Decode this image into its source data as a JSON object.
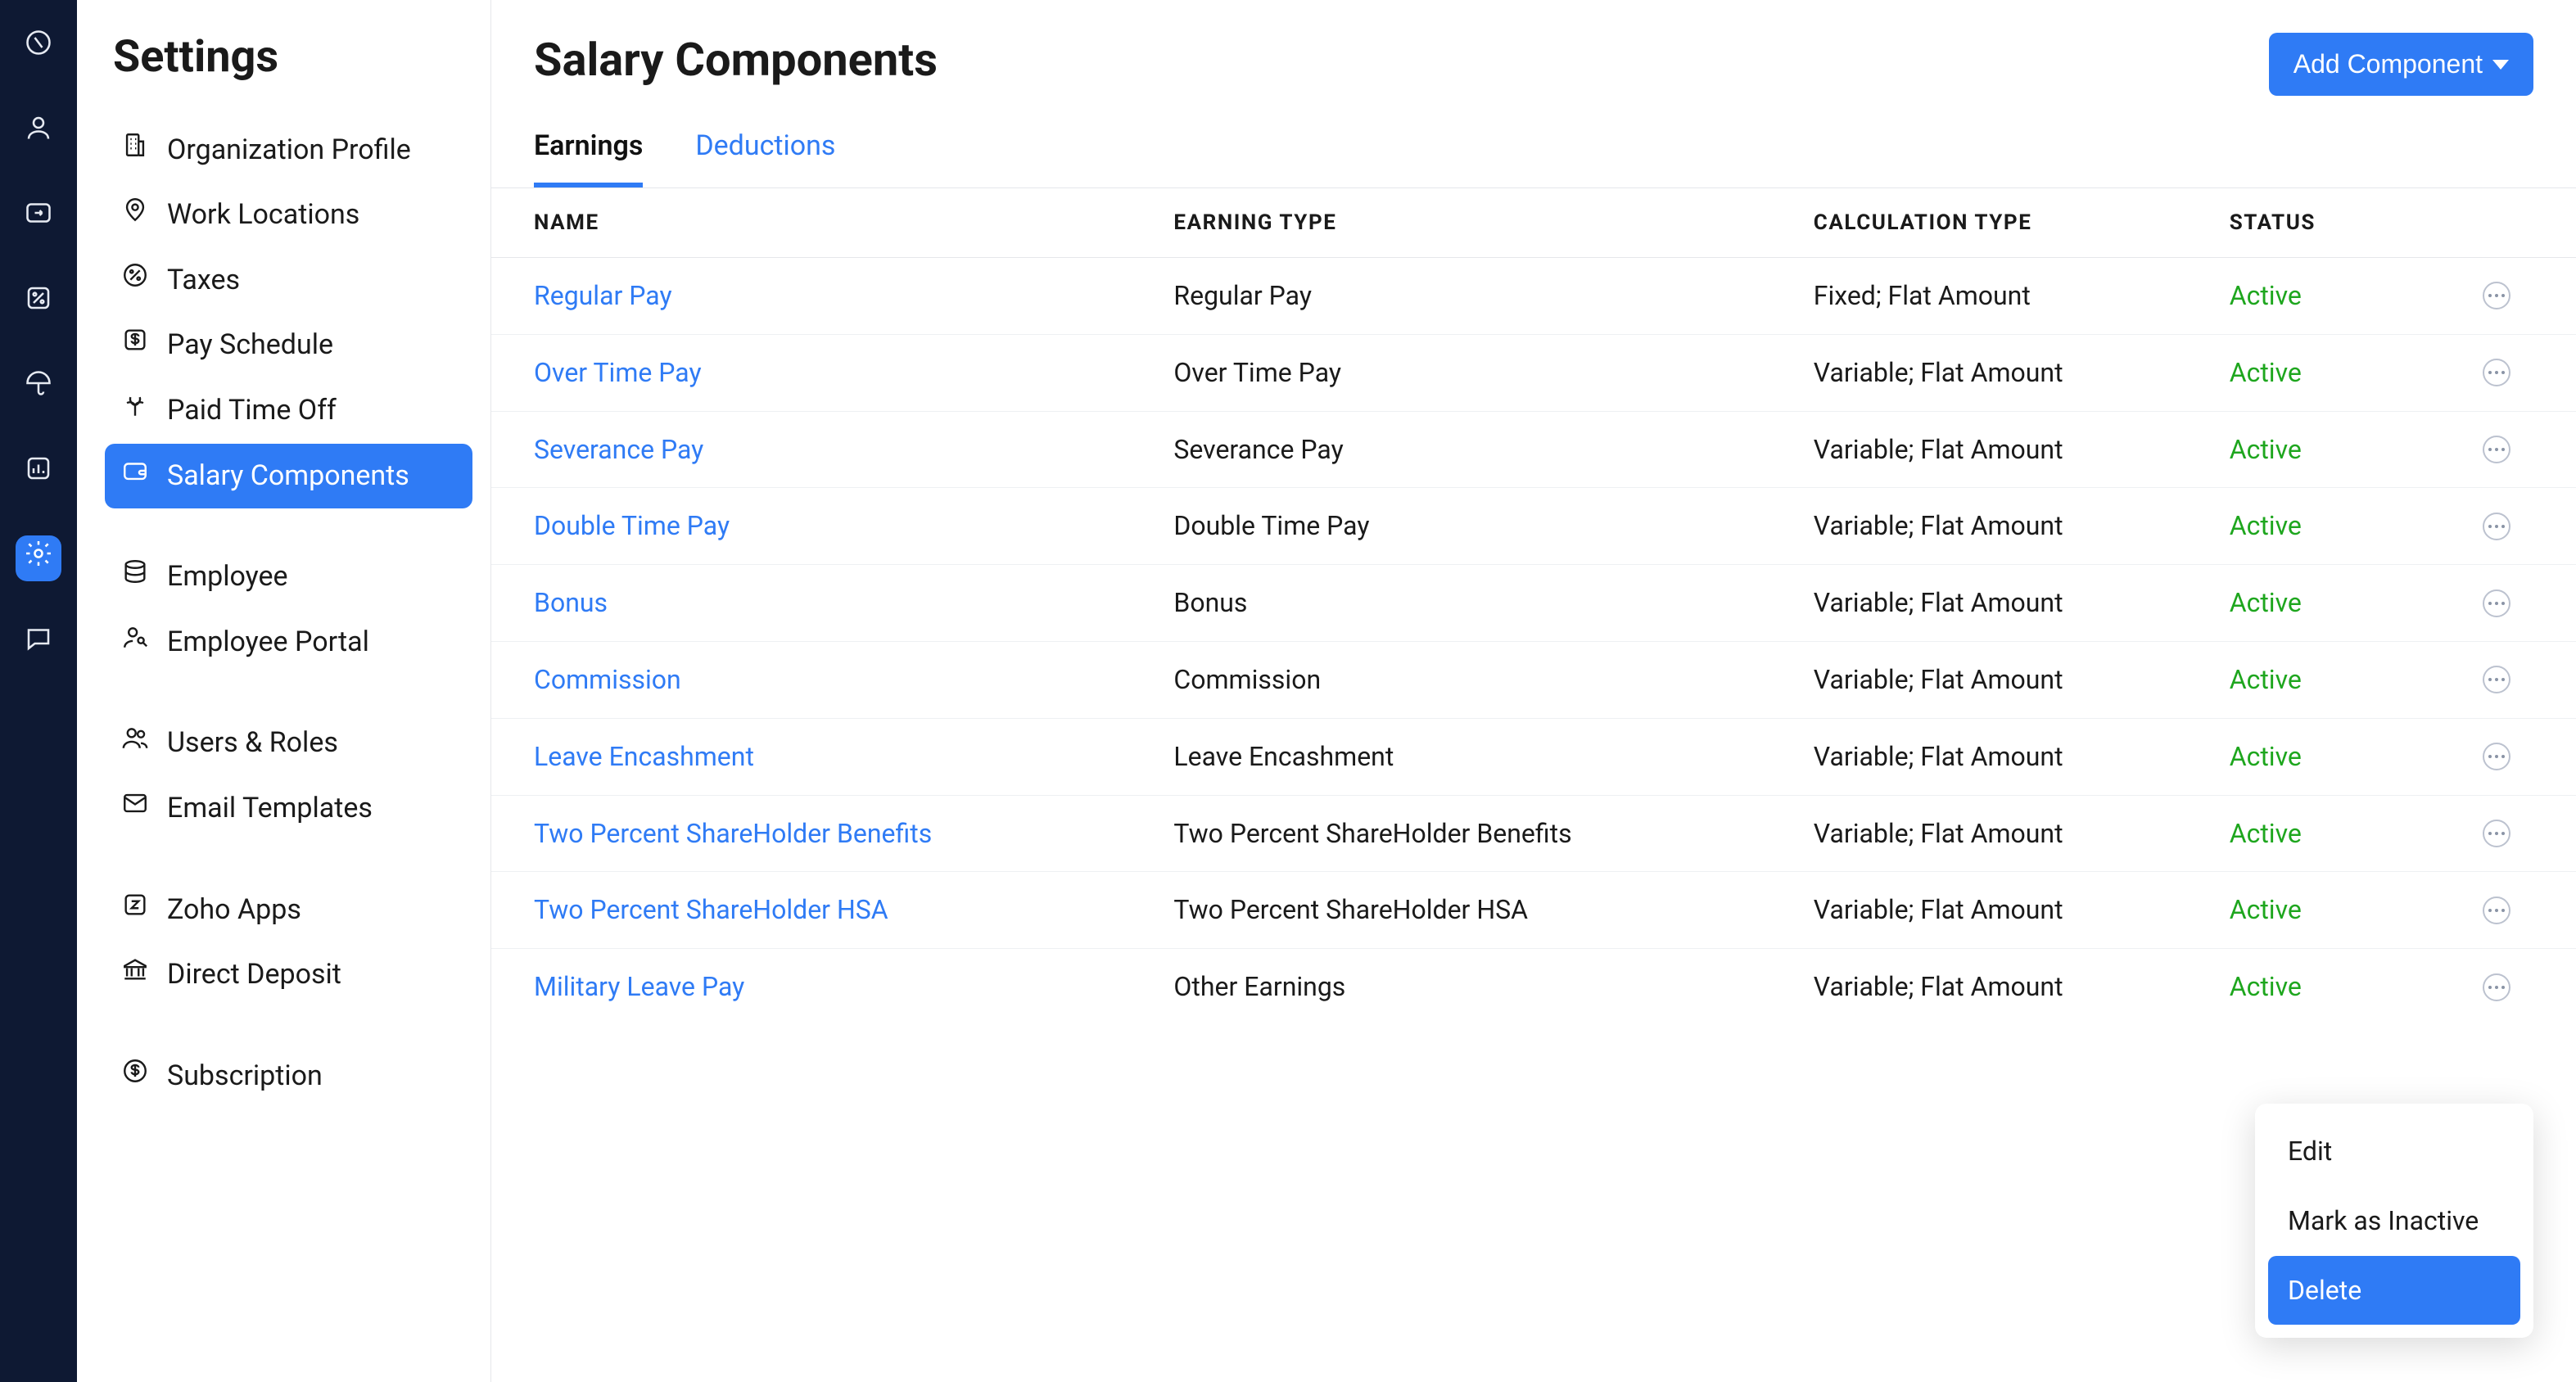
{
  "rail": {
    "items": [
      {
        "id": "dashboard"
      },
      {
        "id": "employee"
      },
      {
        "id": "inbox"
      },
      {
        "id": "charts"
      },
      {
        "id": "umbrella"
      },
      {
        "id": "reports"
      },
      {
        "id": "settings",
        "active": true
      },
      {
        "id": "chat"
      }
    ]
  },
  "sidebar": {
    "title": "Settings",
    "groups": [
      [
        {
          "id": "org-profile",
          "label": "Organization Profile",
          "icon": "building"
        },
        {
          "id": "work-locations",
          "label": "Work Locations",
          "icon": "pin"
        },
        {
          "id": "taxes",
          "label": "Taxes",
          "icon": "percent"
        },
        {
          "id": "pay-schedule",
          "label": "Pay Schedule",
          "icon": "dollar-square"
        },
        {
          "id": "pto",
          "label": "Paid Time Off",
          "icon": "palm"
        },
        {
          "id": "salary-components",
          "label": "Salary Components",
          "icon": "wallet",
          "active": true
        }
      ],
      [
        {
          "id": "employee",
          "label": "Employee",
          "icon": "stack"
        },
        {
          "id": "employee-portal",
          "label": "Employee Portal",
          "icon": "user-key"
        }
      ],
      [
        {
          "id": "users-roles",
          "label": "Users & Roles",
          "icon": "users"
        },
        {
          "id": "email-templates",
          "label": "Email Templates",
          "icon": "envelope"
        }
      ],
      [
        {
          "id": "zoho-apps",
          "label": "Zoho Apps",
          "icon": "z-square"
        },
        {
          "id": "direct-deposit",
          "label": "Direct Deposit",
          "icon": "bank"
        }
      ],
      [
        {
          "id": "subscription",
          "label": "Subscription",
          "icon": "dollar-circle"
        }
      ]
    ]
  },
  "page": {
    "title": "Salary Components",
    "add_button_label": "Add Component"
  },
  "tabs": [
    {
      "id": "earnings",
      "label": "Earnings",
      "active": true
    },
    {
      "id": "deductions",
      "label": "Deductions"
    }
  ],
  "table": {
    "headers": {
      "name": "NAME",
      "earning_type": "EARNING TYPE",
      "calc_type": "CALCULATION TYPE",
      "status": "STATUS"
    },
    "rows": [
      {
        "name": "Regular Pay",
        "earning_type": "Regular Pay",
        "calc_type": "Fixed; Flat Amount",
        "status": "Active"
      },
      {
        "name": "Over Time Pay",
        "earning_type": "Over Time Pay",
        "calc_type": "Variable; Flat Amount",
        "status": "Active"
      },
      {
        "name": "Severance Pay",
        "earning_type": "Severance Pay",
        "calc_type": "Variable; Flat Amount",
        "status": "Active"
      },
      {
        "name": "Double Time Pay",
        "earning_type": "Double Time Pay",
        "calc_type": "Variable; Flat Amount",
        "status": "Active"
      },
      {
        "name": "Bonus",
        "earning_type": "Bonus",
        "calc_type": "Variable; Flat Amount",
        "status": "Active"
      },
      {
        "name": "Commission",
        "earning_type": "Commission",
        "calc_type": "Variable; Flat Amount",
        "status": "Active"
      },
      {
        "name": "Leave Encashment",
        "earning_type": "Leave Encashment",
        "calc_type": "Variable; Flat Amount",
        "status": "Active"
      },
      {
        "name": "Two Percent ShareHolder Benefits",
        "earning_type": "Two Percent ShareHolder Benefits",
        "calc_type": "Variable; Flat Amount",
        "status": "Active"
      },
      {
        "name": "Two Percent ShareHolder HSA",
        "earning_type": "Two Percent ShareHolder HSA",
        "calc_type": "Variable; Flat Amount",
        "status": "Active"
      },
      {
        "name": "Military Leave Pay",
        "earning_type": "Other Earnings",
        "calc_type": "Variable; Flat Amount",
        "status": "Active"
      }
    ]
  },
  "popover": {
    "items": [
      {
        "id": "edit",
        "label": "Edit"
      },
      {
        "id": "inactive",
        "label": "Mark as Inactive"
      },
      {
        "id": "delete",
        "label": "Delete",
        "highlight": true
      }
    ]
  }
}
